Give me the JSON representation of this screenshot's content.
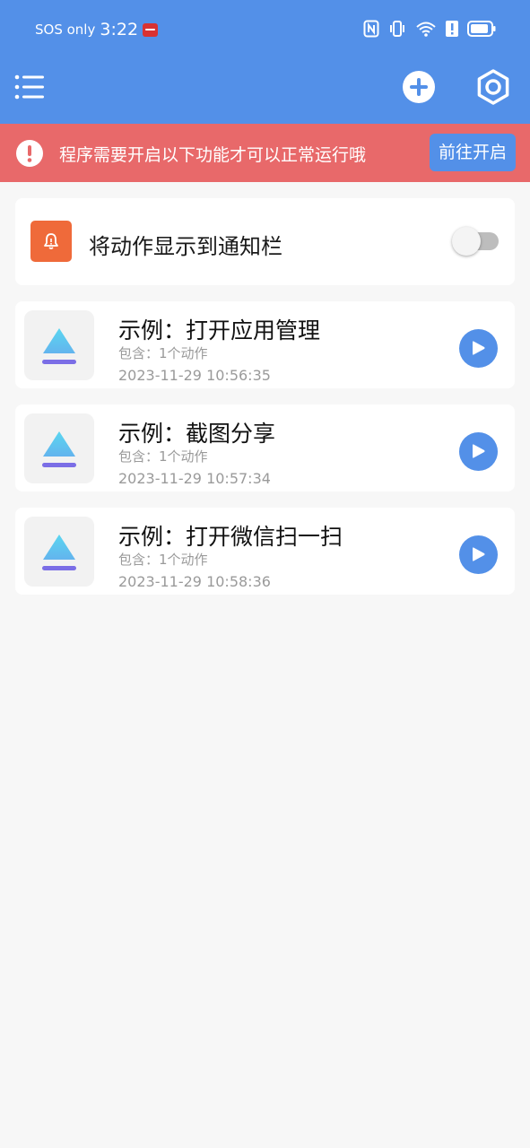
{
  "status_bar": {
    "carrier": "SOS only",
    "time": "3:22",
    "icons": [
      "nfc-icon",
      "vibrate-icon",
      "wifi-icon",
      "alert-icon",
      "battery-icon"
    ]
  },
  "app_bar": {
    "icons": [
      "menu-icon",
      "add-icon",
      "settings-icon"
    ]
  },
  "banner": {
    "message": "程序需要开启以下功能才可以正常运行哦",
    "button_label": "前往开启",
    "icon": "alert-circle-icon"
  },
  "notification_setting": {
    "label": "将动作显示到通知栏",
    "icon": "bell-icon",
    "enabled": false
  },
  "tasks": [
    {
      "title": "示例：打开应用管理",
      "subtitle": "包含：1个动作",
      "date": "2023-11-29 10:56:35"
    },
    {
      "title": "示例：截图分享",
      "subtitle": "包含：1个动作",
      "date": "2023-11-29 10:57:34"
    },
    {
      "title": "示例：打开微信扫一扫",
      "subtitle": "包含：1个动作",
      "date": "2023-11-29 10:58:36"
    }
  ],
  "colors": {
    "primary": "#5390e8",
    "banner": "#e8696a",
    "notify_icon_bg": "#ef6a3a",
    "background": "#f7f7f7"
  }
}
